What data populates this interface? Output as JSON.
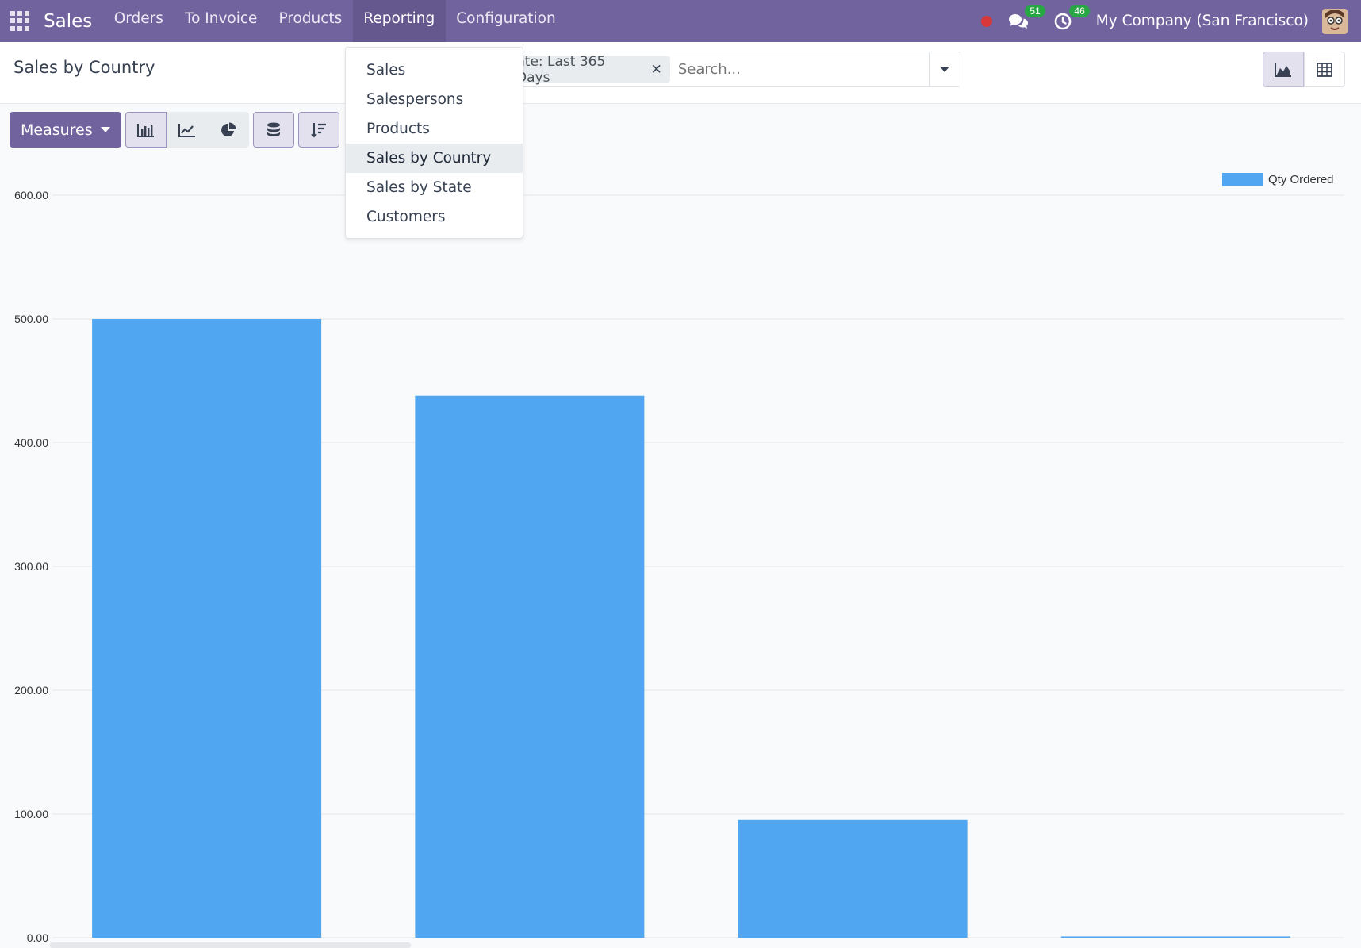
{
  "navbar": {
    "brand": "Sales",
    "menu": [
      "Orders",
      "To Invoice",
      "Products",
      "Reporting",
      "Configuration"
    ],
    "active_menu": "Reporting",
    "messages_count": "51",
    "activities_count": "46",
    "company": "My Company (San Francisco)"
  },
  "control": {
    "title": "Sales by Country",
    "facet_label": "nte: Last 365 Days",
    "search_placeholder": "Search..."
  },
  "toolbar": {
    "measures_label": "Measures"
  },
  "reporting_menu": {
    "items": [
      "Sales",
      "Salespersons",
      "Products",
      "Sales by Country",
      "Sales by State",
      "Customers"
    ],
    "active_item": "Sales by Country"
  },
  "colors": {
    "navbar": "#71639e",
    "bar": "#50a6f0"
  },
  "chart_data": {
    "type": "bar",
    "categories": [
      "",
      "",
      "",
      ""
    ],
    "series": [
      {
        "name": "Qty Ordered",
        "values": [
          500,
          438,
          95,
          1
        ]
      }
    ],
    "ylim": [
      0,
      600
    ],
    "yticks": [
      "0.00",
      "100.00",
      "200.00",
      "300.00",
      "400.00",
      "500.00",
      "600.00"
    ],
    "legend_position": "top-right",
    "grid": true
  }
}
